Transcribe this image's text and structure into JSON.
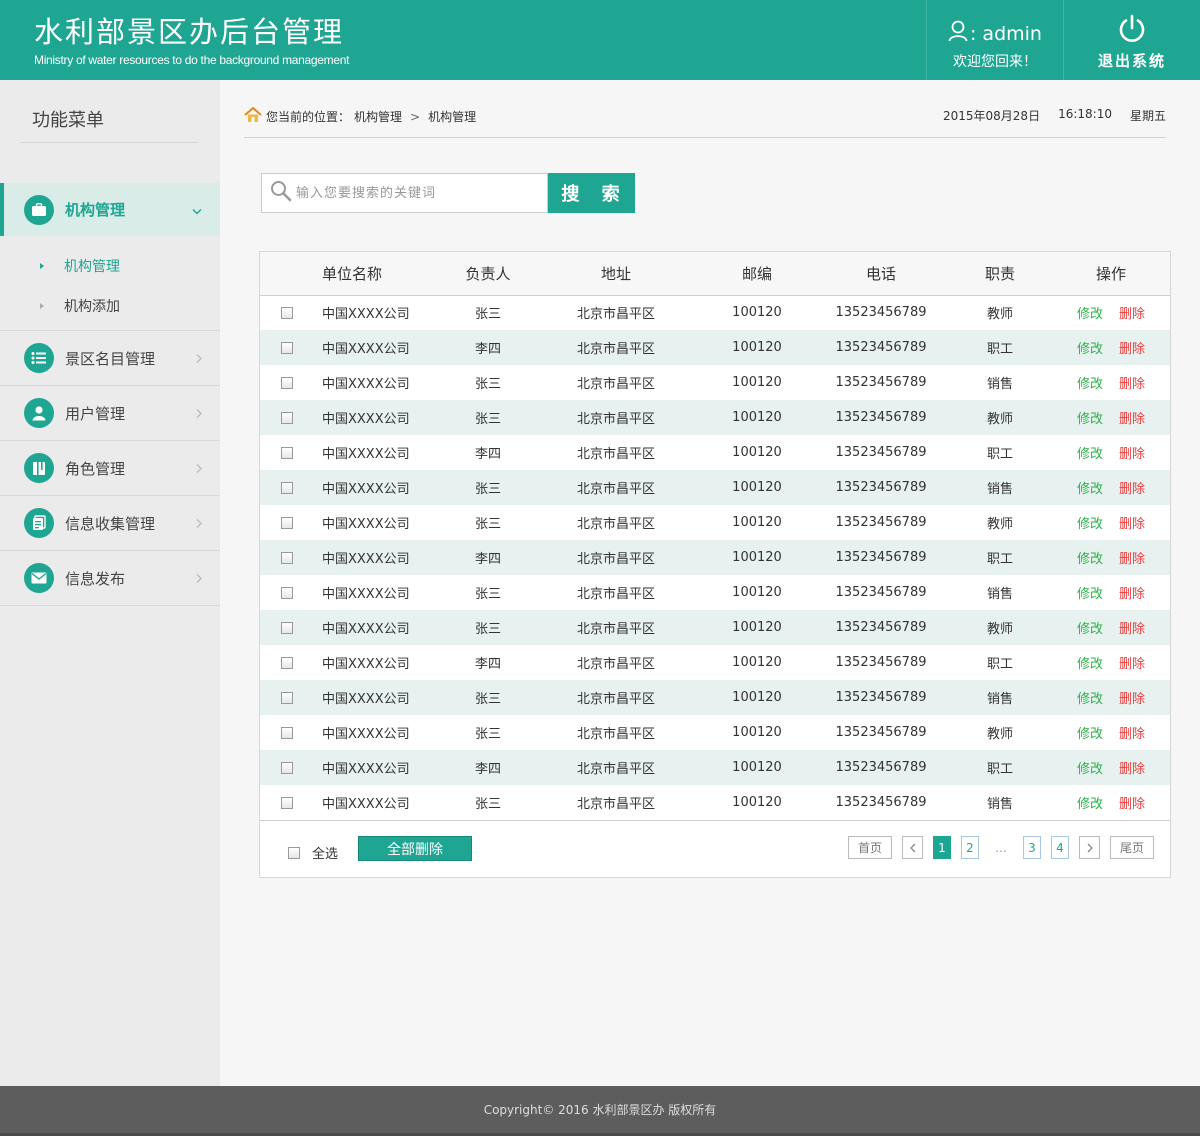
{
  "header": {
    "title": "水利部景区办后台管理",
    "subtitle": "Ministry of water resources to do the background management",
    "user_sep": ":",
    "username": "admin",
    "welcome": "欢迎您回来！",
    "logout_label": "退出系统"
  },
  "sidebar": {
    "title": "功能菜单",
    "active_menu": "机构管理",
    "submenu": [
      "机构管理",
      "机构添加"
    ],
    "items": [
      "景区名目管理",
      "用户管理",
      "角色管理",
      "信息收集管理",
      "信息发布"
    ]
  },
  "breadcrumb": {
    "prefix": "您当前的位置：",
    "level1": "机构管理",
    "level2": "机构管理"
  },
  "datetime": {
    "date": "2015年08月28日",
    "time": "16:18:10",
    "weekday": "星期五"
  },
  "search": {
    "placeholder": "输入您要搜索的关键词",
    "button": "搜 索"
  },
  "table": {
    "columns": [
      "单位名称",
      "负责人",
      "地址",
      "邮编",
      "电话",
      "职责",
      "操作"
    ],
    "edit_label": "修改",
    "delete_label": "删除",
    "rows": [
      [
        "中国XXXX公司",
        "张三",
        "北京市昌平区",
        "100120",
        "13523456789",
        "教师"
      ],
      [
        "中国XXXX公司",
        "李四",
        "北京市昌平区",
        "100120",
        "13523456789",
        "职工"
      ],
      [
        "中国XXXX公司",
        "张三",
        "北京市昌平区",
        "100120",
        "13523456789",
        "销售"
      ],
      [
        "中国XXXX公司",
        "张三",
        "北京市昌平区",
        "100120",
        "13523456789",
        "教师"
      ],
      [
        "中国XXXX公司",
        "李四",
        "北京市昌平区",
        "100120",
        "13523456789",
        "职工"
      ],
      [
        "中国XXXX公司",
        "张三",
        "北京市昌平区",
        "100120",
        "13523456789",
        "销售"
      ],
      [
        "中国XXXX公司",
        "张三",
        "北京市昌平区",
        "100120",
        "13523456789",
        "教师"
      ],
      [
        "中国XXXX公司",
        "李四",
        "北京市昌平区",
        "100120",
        "13523456789",
        "职工"
      ],
      [
        "中国XXXX公司",
        "张三",
        "北京市昌平区",
        "100120",
        "13523456789",
        "销售"
      ],
      [
        "中国XXXX公司",
        "张三",
        "北京市昌平区",
        "100120",
        "13523456789",
        "教师"
      ],
      [
        "中国XXXX公司",
        "李四",
        "北京市昌平区",
        "100120",
        "13523456789",
        "职工"
      ],
      [
        "中国XXXX公司",
        "张三",
        "北京市昌平区",
        "100120",
        "13523456789",
        "销售"
      ],
      [
        "中国XXXX公司",
        "张三",
        "北京市昌平区",
        "100120",
        "13523456789",
        "教师"
      ],
      [
        "中国XXXX公司",
        "李四",
        "北京市昌平区",
        "100120",
        "13523456789",
        "职工"
      ],
      [
        "中国XXXX公司",
        "张三",
        "北京市昌平区",
        "100120",
        "13523456789",
        "销售"
      ]
    ]
  },
  "footer_bar": {
    "select_all": "全选",
    "delete_all": "全部删除"
  },
  "pager": {
    "first": "首页",
    "last": "尾页",
    "pages": [
      "1",
      "2",
      "3",
      "4"
    ],
    "ellipsis": "...",
    "current": "1"
  },
  "footer": {
    "copyright": "Copyright© 2016  水利部景区办 版权所有"
  },
  "colors": {
    "brand": "#1fa693",
    "edit": "#2db14a",
    "delete": "#e53c3c"
  }
}
